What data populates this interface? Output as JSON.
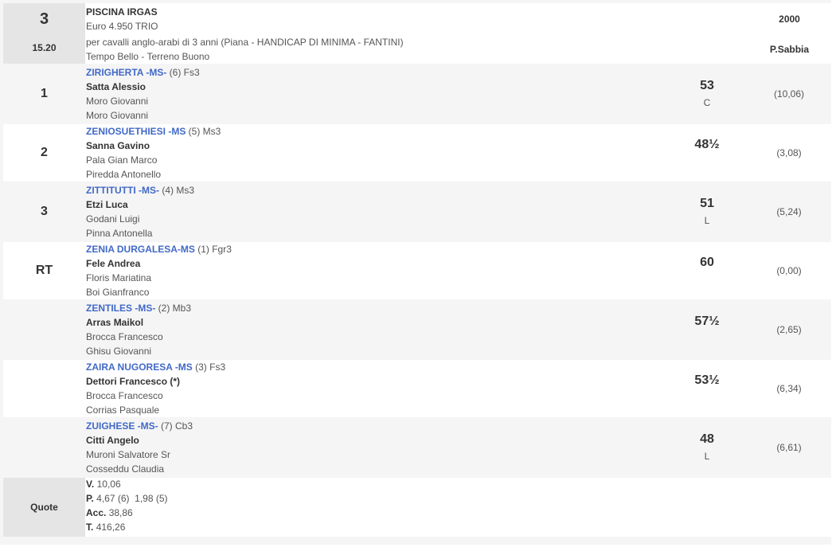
{
  "race": {
    "number": "3",
    "time": "15.20",
    "name": "PISCINA IRGAS",
    "prize": "Euro 4.950 TRIO",
    "description": "per cavalli anglo-arabi di 3 anni (Piana -  HANDICAP DI MINIMA  - FANTINI)",
    "conditions": "Tempo Bello - Terreno Buono",
    "distance": "2000",
    "track": "P.Sabbia"
  },
  "runners": [
    {
      "position": "1",
      "horse": "ZIRIGHERTA -MS-",
      "horse_info": " (6) Fs3",
      "jockey": "Satta Alessio",
      "trainer": "Moro Giovanni",
      "owner": "Moro Giovanni",
      "weight": "53",
      "weight_note": "C",
      "odds": "(10,06)"
    },
    {
      "position": "2",
      "horse": "ZENIOSUETHIESI -MS",
      "horse_info": " (5) Ms3",
      "jockey": "Sanna Gavino",
      "trainer": "Pala Gian Marco",
      "owner": "Piredda Antonello",
      "weight": "48½",
      "weight_note": "",
      "odds": "(3,08)"
    },
    {
      "position": "3",
      "horse": "ZITTITUTTI -MS-",
      "horse_info": " (4) Ms3",
      "jockey": "Etzi Luca",
      "trainer": "Godani Luigi",
      "owner": "Pinna Antonella",
      "weight": "51",
      "weight_note": "L",
      "odds": "(5,24)"
    },
    {
      "position": "RT",
      "horse": "ZENIA DURGALESA-MS",
      "horse_info": " (1) Fgr3",
      "jockey": "Fele Andrea",
      "trainer": "Floris Mariatina",
      "owner": "Boi Gianfranco",
      "weight": "60",
      "weight_note": "",
      "odds": "(0,00)"
    },
    {
      "position": "",
      "horse": "ZENTILES -MS-",
      "horse_info": " (2) Mb3",
      "jockey": "Arras Maikol",
      "trainer": "Brocca Francesco",
      "owner": "Ghisu Giovanni",
      "weight": "57½",
      "weight_note": "",
      "odds": "(2,65)"
    },
    {
      "position": "",
      "horse": "ZAIRA NUGORESA -MS",
      "horse_info": " (3) Fs3",
      "jockey": "Dettori Francesco (*)",
      "trainer": "Brocca Francesco",
      "owner": "Corrias Pasquale",
      "weight": "53½",
      "weight_note": "",
      "odds": "(6,34)"
    },
    {
      "position": "",
      "horse": "ZUIGHESE -MS-",
      "horse_info": " (7) Cb3",
      "jockey": "Citti Angelo",
      "trainer": "Muroni Salvatore Sr",
      "owner": "Cosseddu Claudia",
      "weight": "48",
      "weight_note": "L",
      "odds": "(6,61)"
    }
  ],
  "quote": {
    "label": "Quote",
    "lines": [
      {
        "key": "V.",
        "value": "10,06"
      },
      {
        "key": "P.",
        "value": "4,67 (6)  1,98 (5)"
      },
      {
        "key": "Acc.",
        "value": "38,86"
      },
      {
        "key": "T.",
        "value": "416,26"
      }
    ]
  }
}
